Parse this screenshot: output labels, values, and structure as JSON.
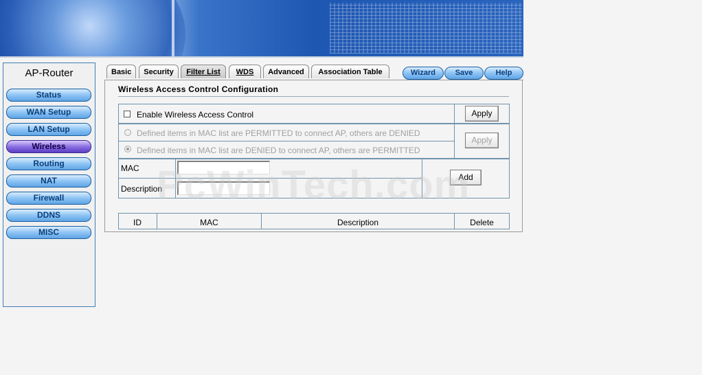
{
  "brand": "AP-Router",
  "nav": [
    {
      "label": "Status",
      "active": false
    },
    {
      "label": "WAN Setup",
      "active": false
    },
    {
      "label": "LAN Setup",
      "active": false
    },
    {
      "label": "Wireless",
      "active": true
    },
    {
      "label": "Routing",
      "active": false
    },
    {
      "label": "NAT",
      "active": false
    },
    {
      "label": "Firewall",
      "active": false
    },
    {
      "label": "DDNS",
      "active": false
    },
    {
      "label": "MISC",
      "active": false
    }
  ],
  "tabs": [
    {
      "label": "Basic"
    },
    {
      "label": "Security"
    },
    {
      "label": "Filter List",
      "active": true
    },
    {
      "label": "WDS"
    },
    {
      "label": "Advanced"
    },
    {
      "label": "Association Table"
    }
  ],
  "actions": {
    "wizard": "Wizard",
    "save": "Save",
    "help": "Help"
  },
  "page_title": "Wireless Access Control Configuration",
  "enable": {
    "label": "Enable Wireless Access Control",
    "checked": false,
    "apply": "Apply"
  },
  "policy": {
    "permit_label": "Defined items in MAC list are PERMITTED to connect AP, others are DENIED",
    "deny_label": "Defined items in MAC list are DENIED to connect AP, others are PERMITTED",
    "selected": "deny",
    "apply": "Apply"
  },
  "entry": {
    "mac_label": "MAC",
    "mac_value": "",
    "desc_label": "Description",
    "desc_value": "",
    "add": "Add"
  },
  "table": {
    "headers": [
      "ID",
      "MAC",
      "Description",
      "Delete"
    ],
    "rows": []
  },
  "watermark": "PcWinTech.com"
}
